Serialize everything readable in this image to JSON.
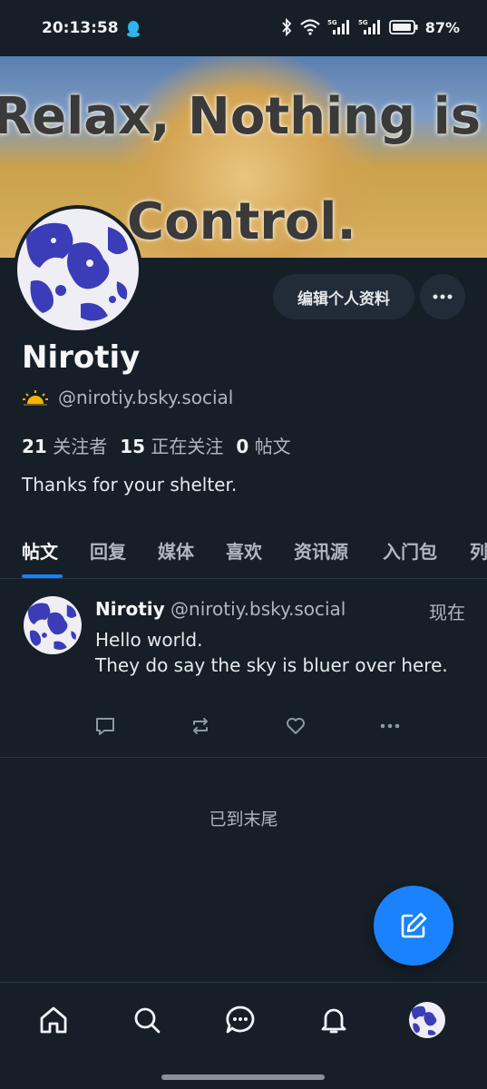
{
  "status_bar": {
    "time": "20:13:58",
    "battery": "87%",
    "icons": [
      "qq-icon",
      "bluetooth-icon",
      "wifi-icon",
      "signal-5g-icon",
      "signal-5g-icon",
      "battery-icon"
    ]
  },
  "banner": {
    "line1": "Relax, Nothing is i",
    "line2": "Control."
  },
  "profile": {
    "display_name": "Nirotiy",
    "handle": "@nirotiy.bsky.social",
    "edit_button": "编辑个人资料",
    "followers_count": "21",
    "followers_label": "关注者",
    "following_count": "15",
    "following_label": "正在关注",
    "posts_count": "0",
    "posts_label": "帖文",
    "bio": "Thanks for your shelter."
  },
  "tabs": [
    {
      "label": "帖文",
      "active": true
    },
    {
      "label": "回复",
      "active": false
    },
    {
      "label": "媒体",
      "active": false
    },
    {
      "label": "喜欢",
      "active": false
    },
    {
      "label": "资讯源",
      "active": false
    },
    {
      "label": "入门包",
      "active": false
    },
    {
      "label": "列",
      "active": false
    }
  ],
  "post": {
    "author": "Nirotiy",
    "handle": "@nirotiy.bsky.social",
    "time": "现在",
    "line1": "Hello world.",
    "line2": "They do say the sky is bluer over here."
  },
  "feed_end": "已到末尾",
  "colors": {
    "background": "#161e27",
    "accent": "#1083fe",
    "fab": "#1a82fd",
    "muted_text": "#aeb6bf"
  }
}
